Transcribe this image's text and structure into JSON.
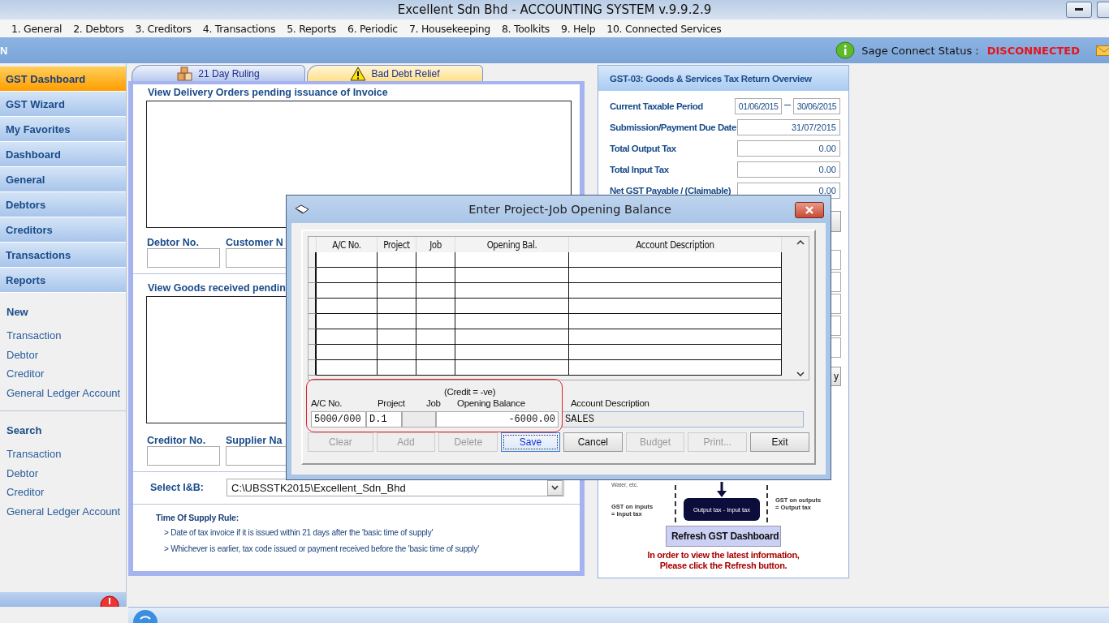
{
  "window": {
    "title": "Excellent Sdn Bhd - ACCOUNTING SYSTEM v.9.9.2.9"
  },
  "menu": [
    "1. General",
    "2. Debtors",
    "3. Creditors",
    "4. Transactions",
    "5. Reports",
    "6. Periodic",
    "7. Housekeeping",
    "8. Toolkits",
    "9. Help",
    "10. Connected Services"
  ],
  "status_band": {
    "left_text": "N",
    "label": "Sage Connect Status :",
    "status": "DISCONNECTED"
  },
  "sidebar": {
    "nav": [
      {
        "label": "GST Dashboard",
        "selected": true
      },
      {
        "label": "GST Wizard",
        "selected": false
      },
      {
        "label": "My Favorites",
        "selected": false
      },
      {
        "label": "Dashboard",
        "selected": false
      },
      {
        "label": "General",
        "selected": false
      },
      {
        "label": "Debtors",
        "selected": false
      },
      {
        "label": "Creditors",
        "selected": false
      },
      {
        "label": "Transactions",
        "selected": false
      },
      {
        "label": "Reports",
        "selected": false
      }
    ],
    "sections": [
      {
        "title": "New",
        "items": [
          "Transaction",
          "Debtor",
          "Creditor",
          "General Ledger Account"
        ]
      },
      {
        "title": "Search",
        "items": [
          "Transaction",
          "Debtor",
          "Creditor",
          "General Ledger Account"
        ]
      }
    ]
  },
  "tabs": [
    {
      "label": "21 Day Ruling",
      "selected": true,
      "kind": "boxes"
    },
    {
      "label": "Bad Debt Relief",
      "selected": false,
      "kind": "warning"
    }
  ],
  "delivery_orders": {
    "title": "View Delivery Orders pending issuance of Invoice",
    "fields": [
      "Debtor No.",
      "Customer N"
    ]
  },
  "goods_received": {
    "title": "View Goods received pendin",
    "fields": [
      "Creditor No.",
      "Supplier Na"
    ]
  },
  "select_ib": {
    "label": "Select I&B:",
    "value": "C:\\UBSSTK2015\\Excellent_Sdn_Bhd"
  },
  "supply_rule": {
    "title": "Time Of Supply Rule:",
    "lines": [
      "> Date of tax invoice if it is issued within 21 days after the 'basic time of supply'",
      "> Whichever is earlier, tax code issued or payment received before the 'basic time of supply'"
    ]
  },
  "gst_overview": {
    "title": "GST-03: Goods & Services Tax Return Overview",
    "rows": [
      {
        "label": "Current Taxable Period",
        "values": [
          "01/06/2015",
          "30/06/2015"
        ]
      },
      {
        "label": "Submission/Payment Due Date",
        "values": [
          "31/07/2015"
        ]
      },
      {
        "label": "Total Output Tax",
        "values": [
          "0.00"
        ]
      },
      {
        "label": "Total Input Tax",
        "values": [
          "0.00"
        ]
      },
      {
        "label": "Net GST Payable / (Claimable)",
        "values": [
          "0.00"
        ]
      }
    ],
    "hidden_button_tail": "y",
    "diagram": {
      "top_text": "Water, etc.",
      "left": [
        "GST on inputs",
        "= Input tax"
      ],
      "center": "Output tax - Input tax",
      "right": [
        "GST on outputs",
        "= Output tax"
      ]
    },
    "refresh_button": "Refresh GST Dashboard",
    "note": [
      "In order to view the latest information,",
      "Please click the Refresh button."
    ]
  },
  "dialog": {
    "title": "Enter Project-Job Opening Balance",
    "columns": [
      "A/C No.",
      "Project",
      "Job",
      "Opening Bal.",
      "Account Description"
    ],
    "credit_note": "(Credit = -ve)",
    "entry": [
      {
        "label": "A/C No.",
        "value": "5000/000",
        "kind": "text",
        "disabled": false
      },
      {
        "label": "Project",
        "value": "D.1",
        "kind": "text",
        "disabled": false
      },
      {
        "label": "Job",
        "kind": "text",
        "disabled": true
      },
      {
        "label": "Opening Balance",
        "value": "-6000.00",
        "kind": "amount",
        "disabled": false
      },
      {
        "label": "Account Description",
        "value": "SALES",
        "kind": "text",
        "disabled": true
      }
    ],
    "buttons": [
      {
        "label": "Clear",
        "disabled": true,
        "focused": false
      },
      {
        "label": "Add",
        "disabled": true,
        "focused": false
      },
      {
        "label": "Delete",
        "disabled": true,
        "focused": false
      },
      {
        "label": "Save",
        "disabled": false,
        "focused": true
      },
      {
        "label": "Cancel",
        "disabled": false,
        "focused": false
      },
      {
        "label": "Budget",
        "disabled": true,
        "focused": false
      },
      {
        "label": "Print...",
        "disabled": true,
        "focused": false
      },
      {
        "label": "Exit",
        "disabled": false,
        "focused": false
      }
    ]
  }
}
